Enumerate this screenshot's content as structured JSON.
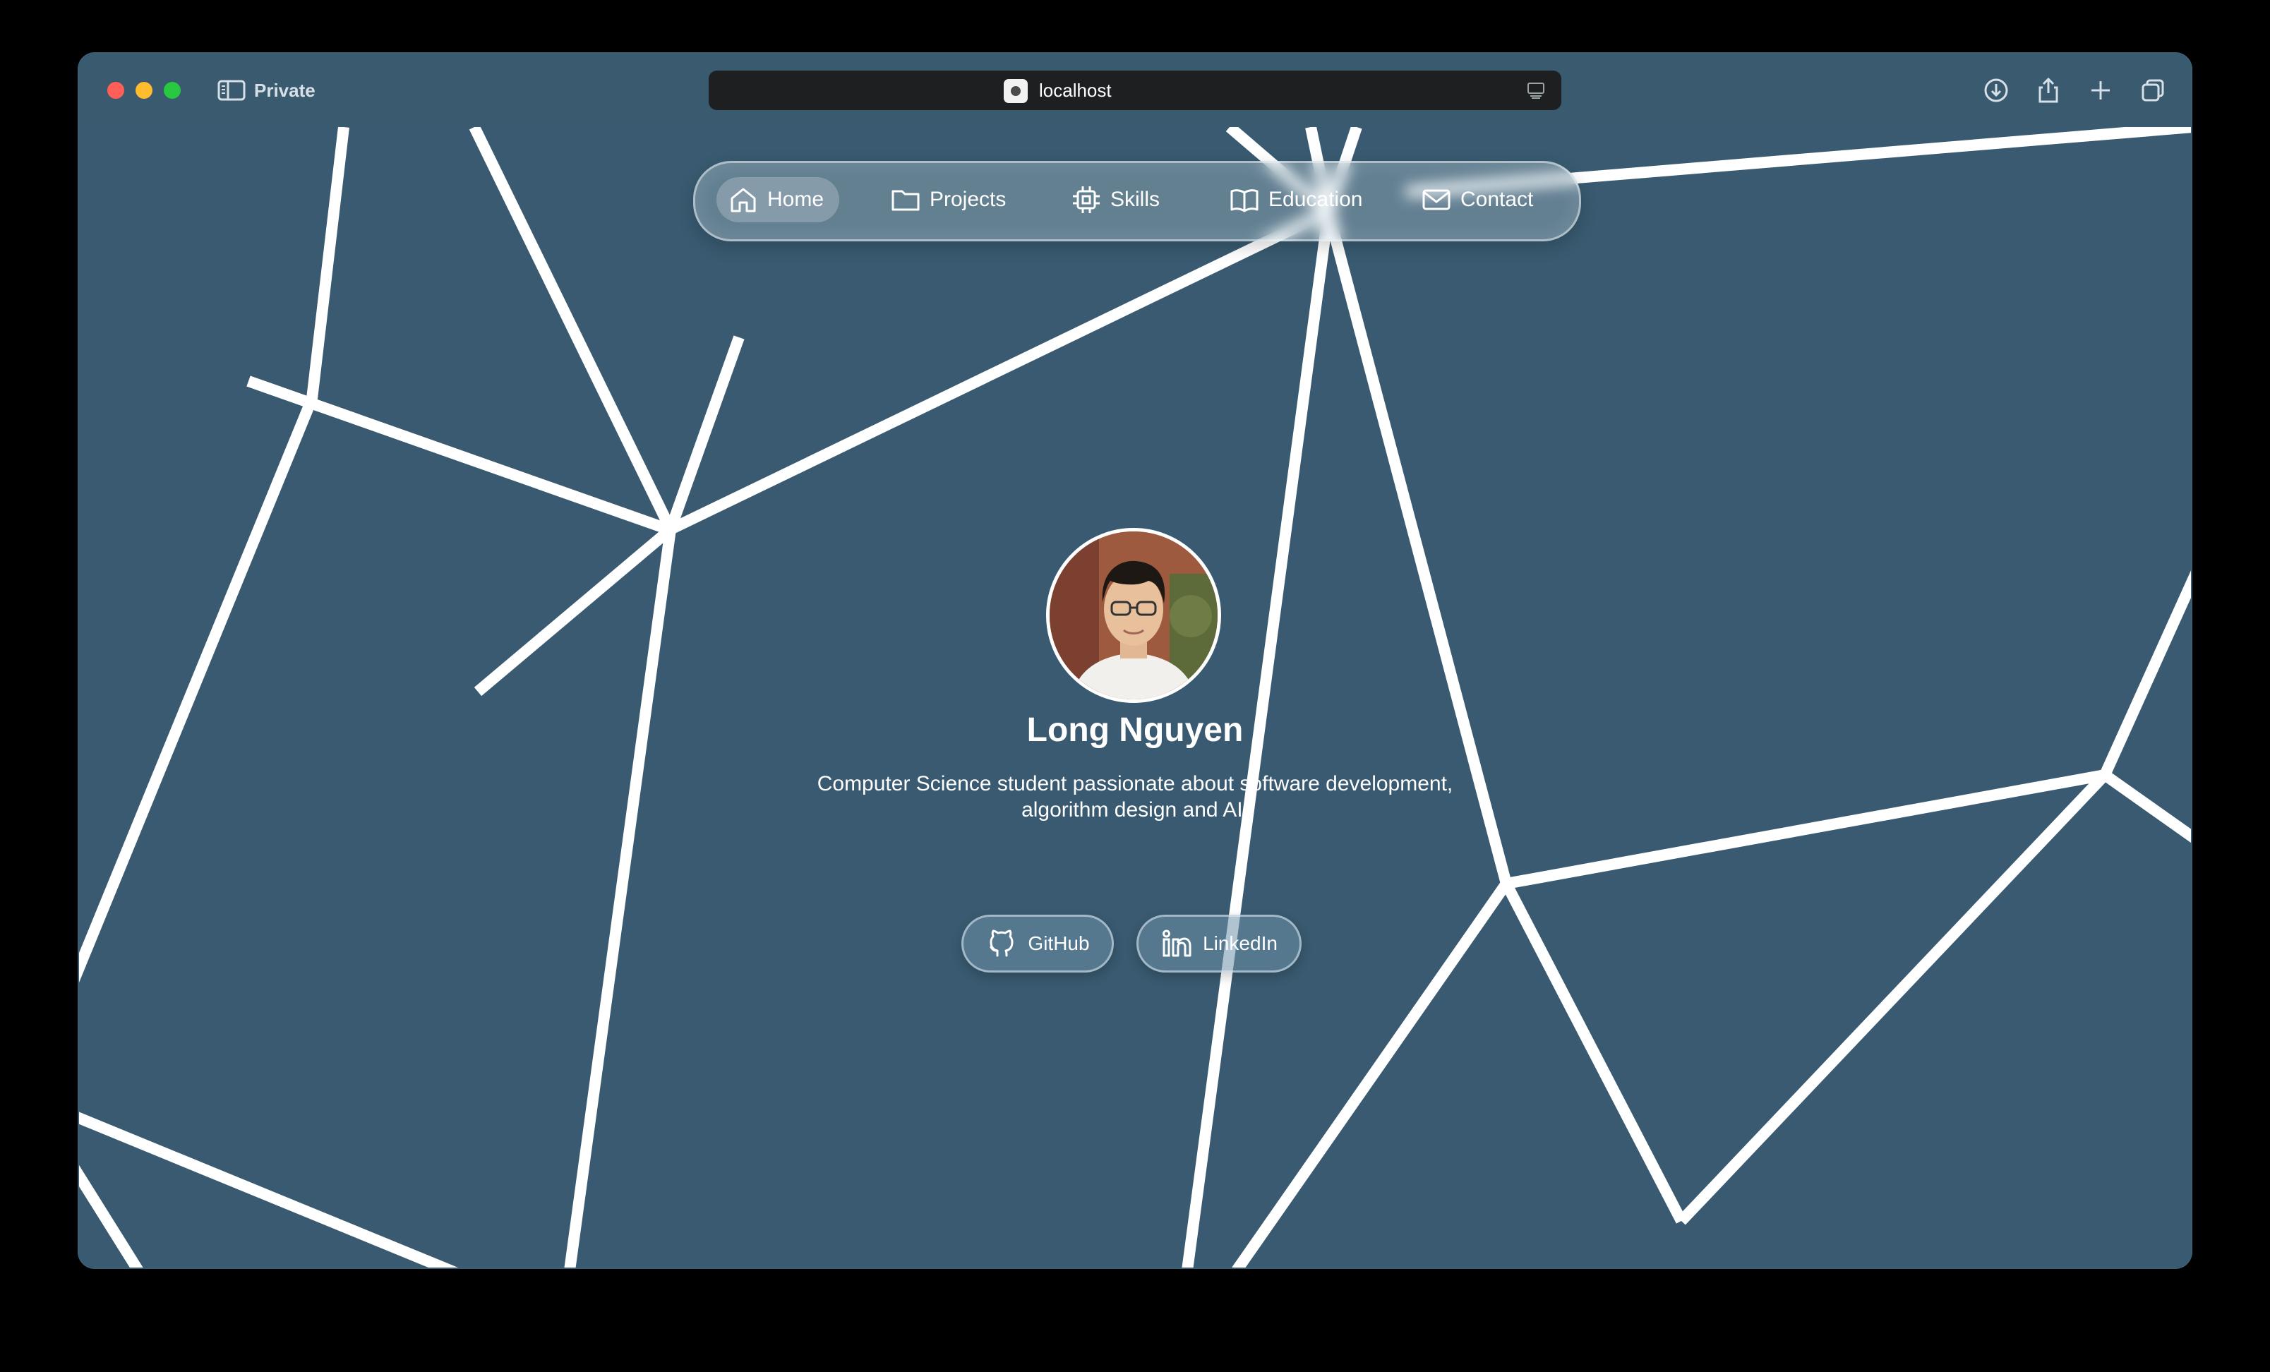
{
  "browser": {
    "mode_label": "Private",
    "url": "localhost"
  },
  "nav": {
    "items": [
      {
        "label": "Home",
        "icon": "home-icon",
        "active": true
      },
      {
        "label": "Projects",
        "icon": "folder-icon",
        "active": false
      },
      {
        "label": "Skills",
        "icon": "chip-icon",
        "active": false
      },
      {
        "label": "Education",
        "icon": "book-icon",
        "active": false
      },
      {
        "label": "Contact",
        "icon": "mail-icon",
        "active": false
      }
    ]
  },
  "profile": {
    "name": "Long Nguyen",
    "bio": "Computer Science student passionate about software development, algorithm design and AI.",
    "avatar": "profile-photo"
  },
  "social": {
    "github_label": "GitHub",
    "linkedin_label": "LinkedIn"
  },
  "theme": {
    "background": "#395a70",
    "line_color": "#ffffff",
    "accent_text": "#ffffff"
  }
}
